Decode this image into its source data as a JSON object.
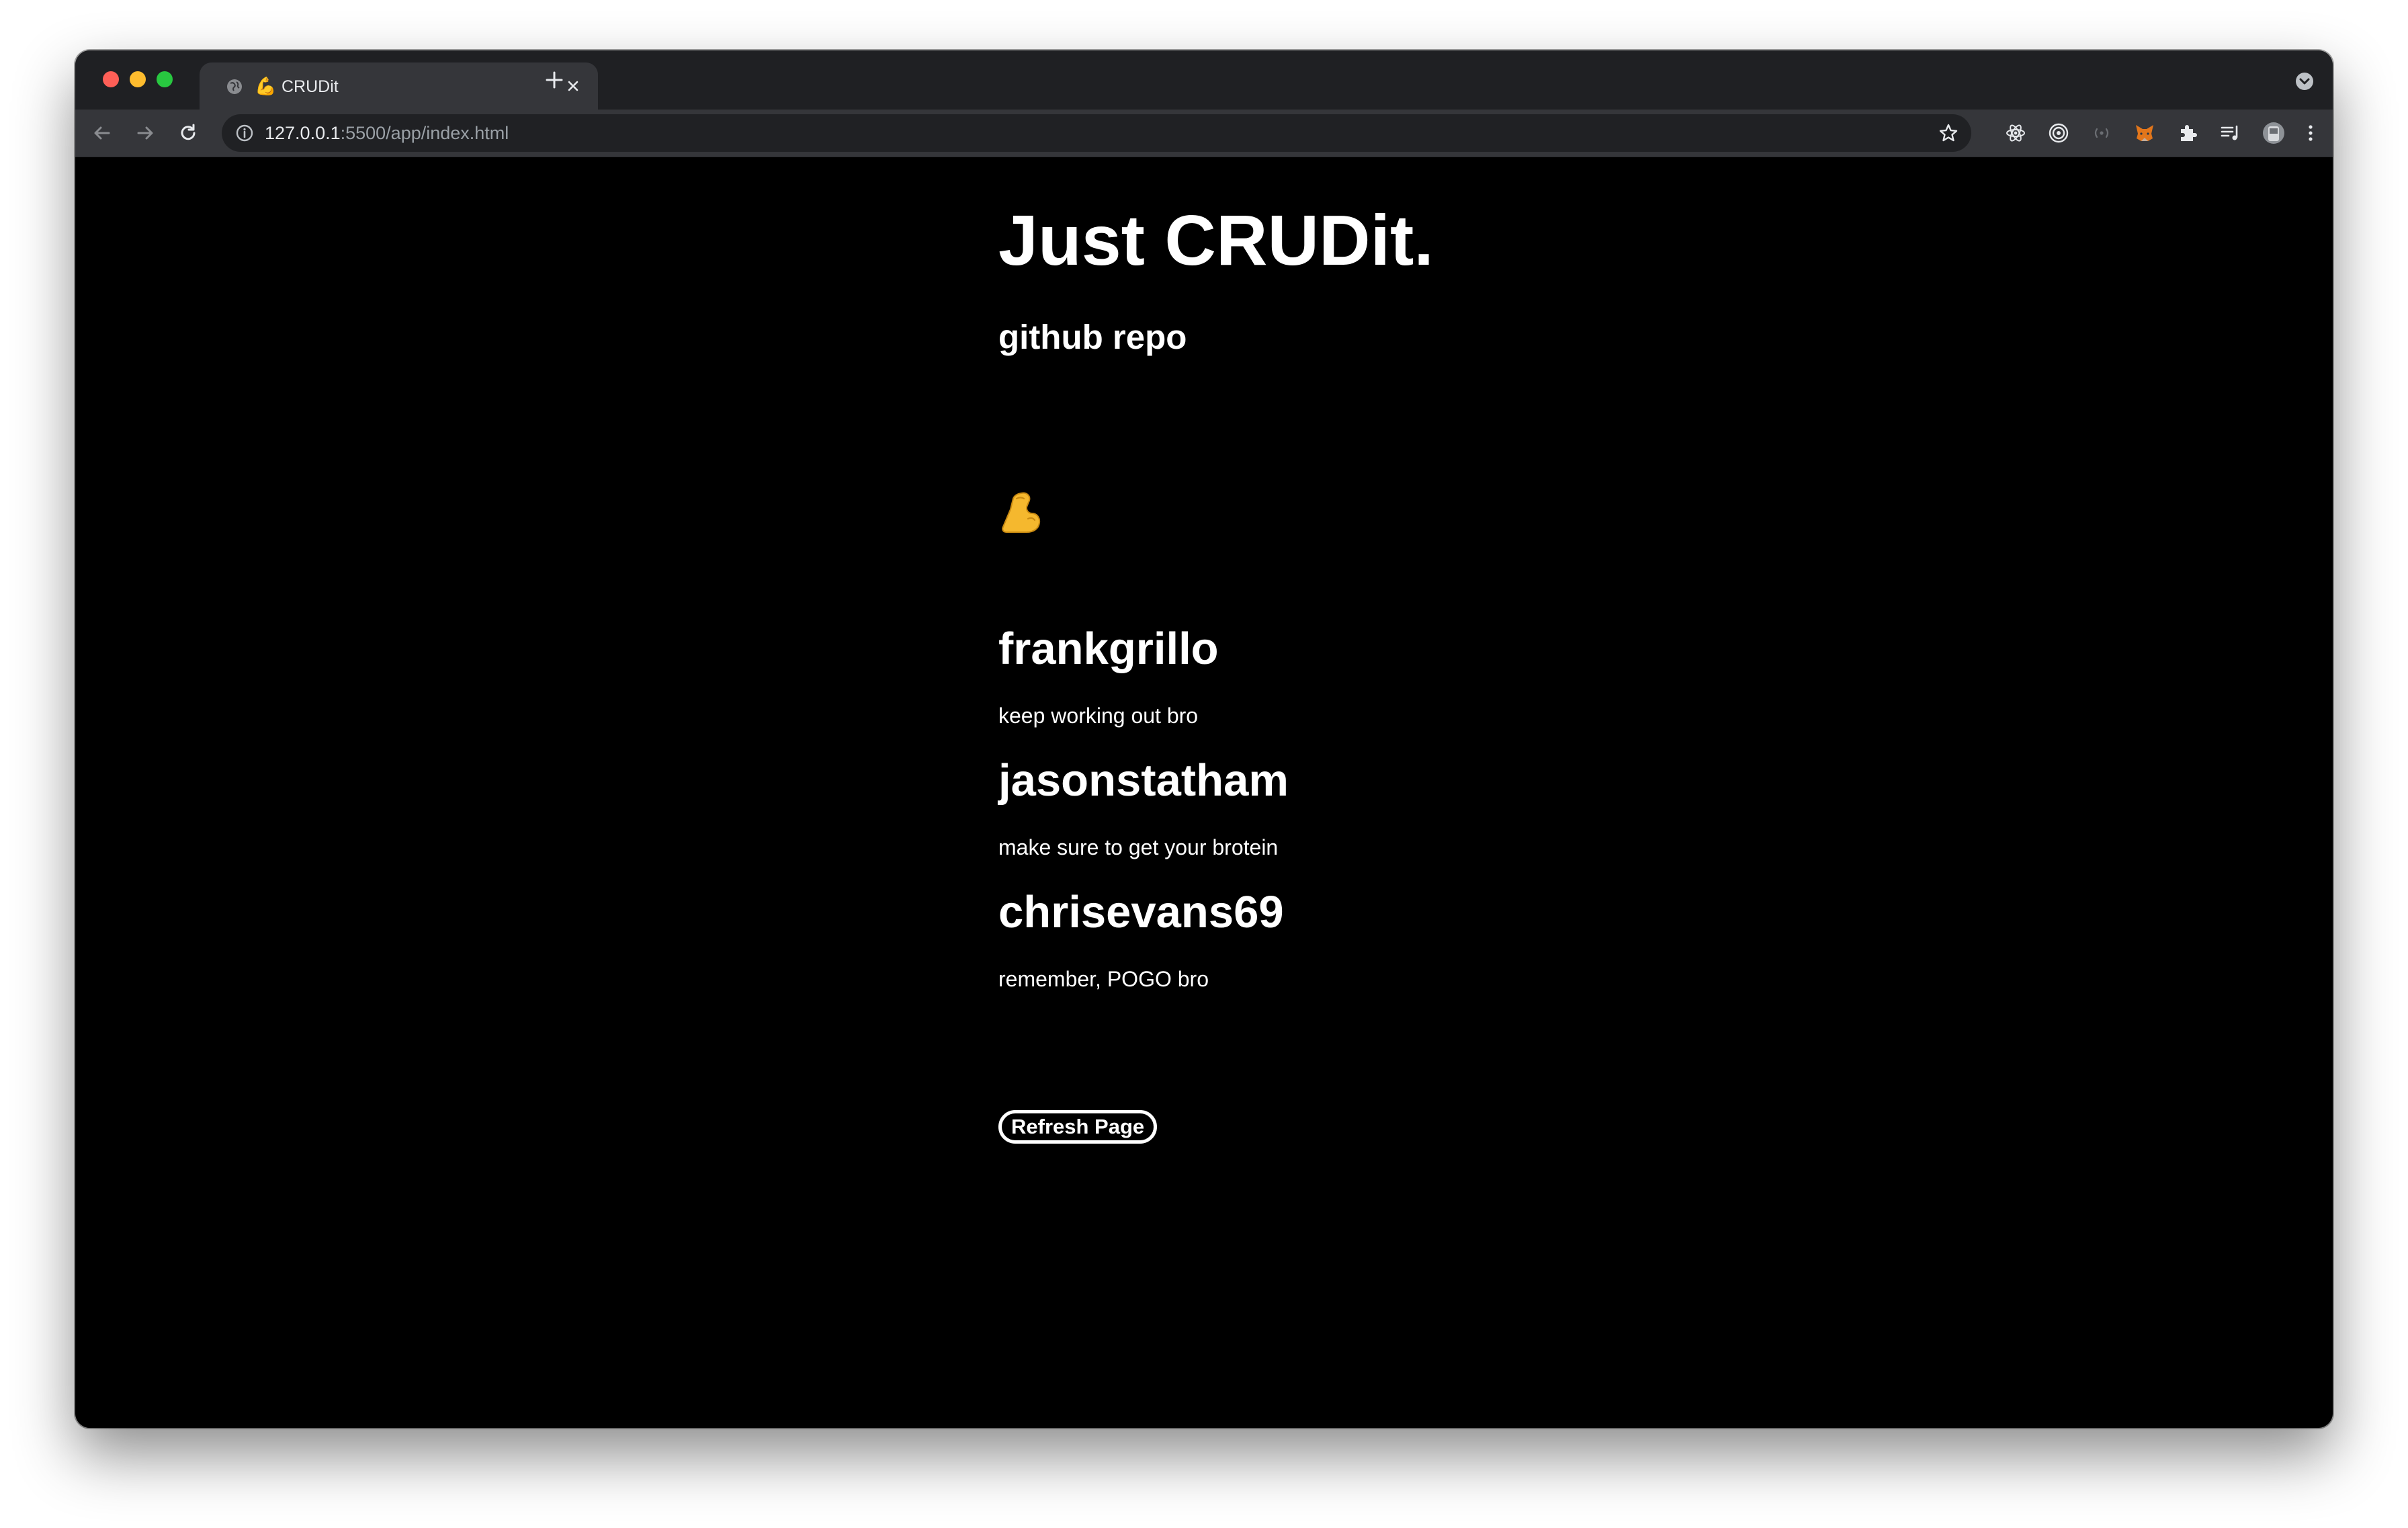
{
  "browser": {
    "tab_title": "CRUDit",
    "tab_favicon": "💪",
    "url_host": "127.0.0.1",
    "url_rest": ":5500/app/index.html"
  },
  "page": {
    "title": "Just CRUDit.",
    "repo_link": "github repo",
    "emoji_icon": "flexed-biceps-icon",
    "posts": [
      {
        "username": "frankgrillo",
        "message": "keep working out bro"
      },
      {
        "username": "jasonstatham",
        "message": "make sure to get your brotein"
      },
      {
        "username": "chrisevans69",
        "message": "remember, POGO bro"
      }
    ],
    "refresh_label": "Refresh Page"
  },
  "colors": {
    "page_background": "#000000",
    "text": "#ffffff",
    "chrome_tabstrip": "#1f2023",
    "chrome_toolbar": "#35363a",
    "omnibox": "#202124"
  }
}
